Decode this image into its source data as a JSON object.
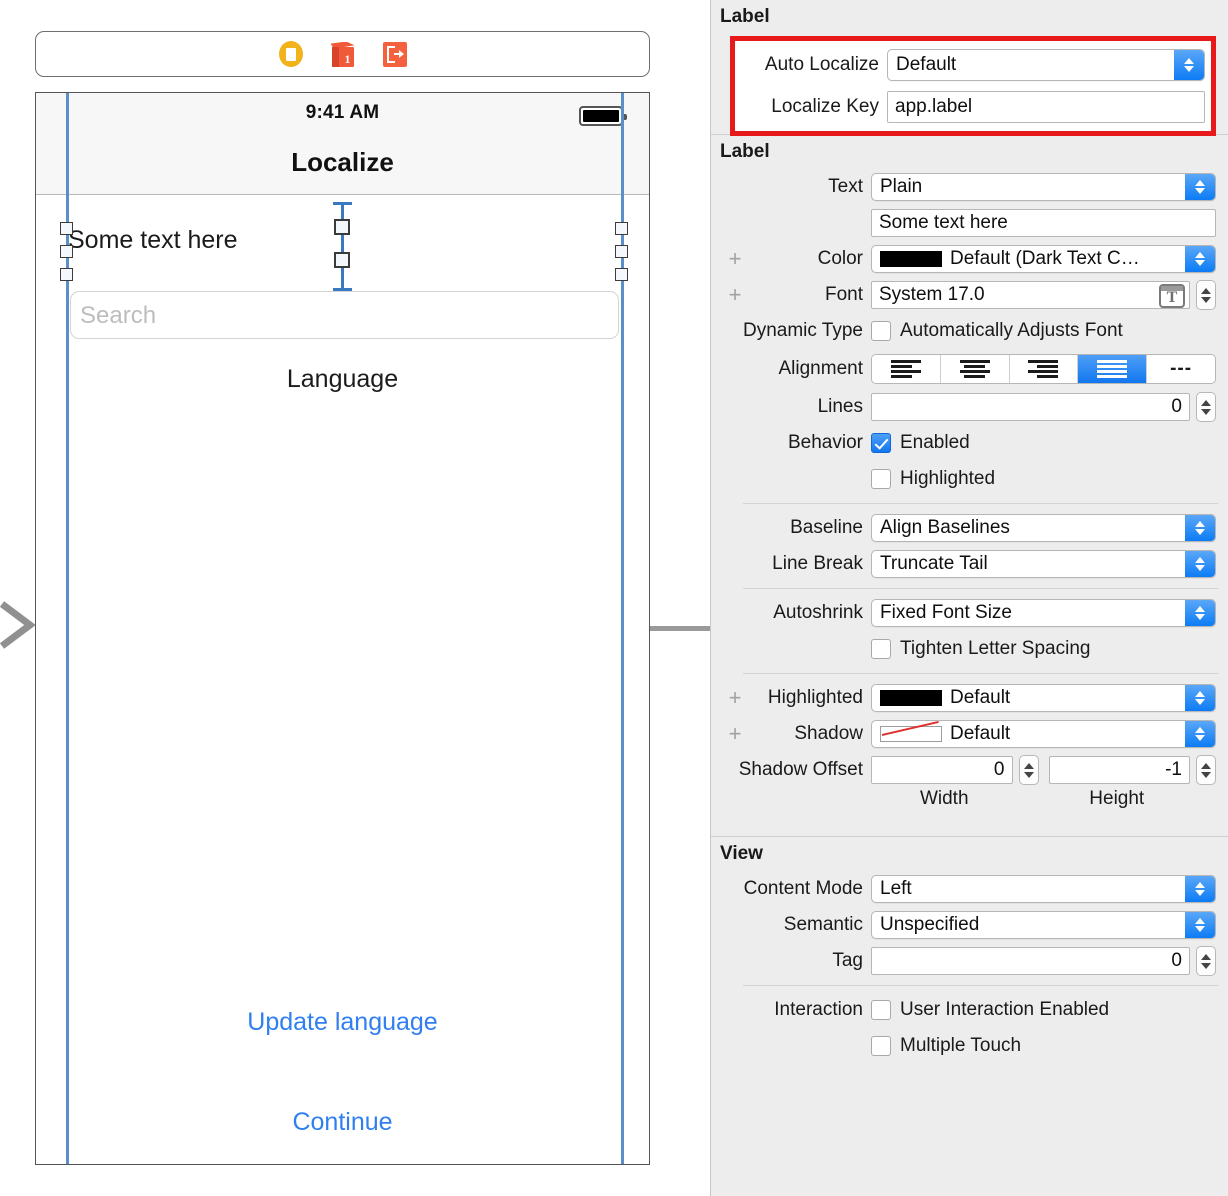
{
  "canvas": {
    "scene_dock": {
      "icons": [
        {
          "name": "view-controller-icon",
          "label": "View Controller"
        },
        {
          "name": "first-responder-icon",
          "label": "First Responder"
        },
        {
          "name": "exit-icon",
          "label": "Exit"
        }
      ]
    },
    "device": {
      "status_bar": {
        "time": "9:41 AM",
        "battery": "full"
      },
      "nav_title": "Localize",
      "label_text": "Some text here",
      "search_placeholder": "Search",
      "language_label": "Language",
      "update_link": "Update language",
      "continue_link": "Continue"
    }
  },
  "inspector": {
    "localize_section": {
      "title": "Label",
      "auto_localize_label": "Auto Localize",
      "auto_localize_value": "Default",
      "localize_key_label": "Localize Key",
      "localize_key_value": "app.label",
      "highlight_color": "#e8191b"
    },
    "label_section": {
      "title": "Label",
      "text_label": "Text",
      "text_value": "Plain",
      "text_content": "Some text here",
      "color_label": "Color",
      "color_value": "Default (Dark Text C…",
      "color_swatch": "#000000",
      "font_label": "Font",
      "font_value": "System 17.0",
      "dynamic_type_label": "Dynamic Type",
      "dynamic_type_checkbox": "Automatically Adjusts Font",
      "dynamic_type_checked": false,
      "alignment_label": "Alignment",
      "alignment_options": [
        "left",
        "center",
        "right",
        "justified",
        "natural"
      ],
      "alignment_selected": 3,
      "lines_label": "Lines",
      "lines_value": "0",
      "behavior_label": "Behavior",
      "behavior_enabled_label": "Enabled",
      "behavior_enabled_checked": true,
      "behavior_highlighted_label": "Highlighted",
      "behavior_highlighted_checked": false,
      "baseline_label": "Baseline",
      "baseline_value": "Align Baselines",
      "line_break_label": "Line Break",
      "line_break_value": "Truncate Tail",
      "autoshrink_label": "Autoshrink",
      "autoshrink_value": "Fixed Font Size",
      "tighten_label": "Tighten Letter Spacing",
      "tighten_checked": false,
      "highlighted_label": "Highlighted",
      "highlighted_value": "Default",
      "highlighted_swatch": "#000000",
      "shadow_label": "Shadow",
      "shadow_value": "Default",
      "shadow_offset_label": "Shadow Offset",
      "shadow_offset_width": "0",
      "shadow_offset_height": "-1",
      "shadow_width_caption": "Width",
      "shadow_height_caption": "Height"
    },
    "view_section": {
      "title": "View",
      "content_mode_label": "Content Mode",
      "content_mode_value": "Left",
      "semantic_label": "Semantic",
      "semantic_value": "Unspecified",
      "tag_label": "Tag",
      "tag_value": "0",
      "interaction_label": "Interaction",
      "user_interaction_label": "User Interaction Enabled",
      "user_interaction_checked": false,
      "multiple_touch_label": "Multiple Touch",
      "multiple_touch_checked": false
    }
  }
}
